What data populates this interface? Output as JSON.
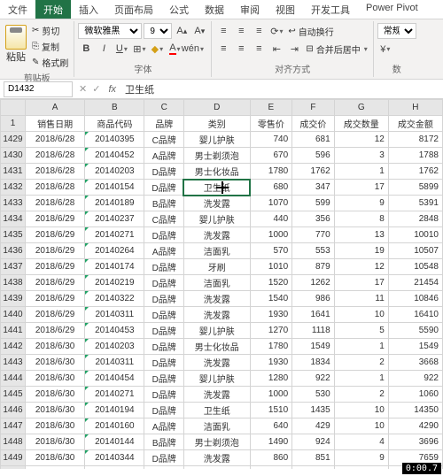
{
  "tabs": [
    "文件",
    "开始",
    "插入",
    "页面布局",
    "公式",
    "数据",
    "审阅",
    "视图",
    "开发工具",
    "Power Pivot"
  ],
  "activeTab": 1,
  "ribbon": {
    "paste": "粘贴",
    "cut": "剪切",
    "copy": "复制",
    "formatPainter": "格式刷",
    "clipboardLabel": "剪贴板",
    "fontName": "微软雅黑",
    "fontSize": "9",
    "fontLabel": "字体",
    "wrap": "自动换行",
    "merge": "合并后居中",
    "alignLabel": "对齐方式",
    "numFormat": "常规",
    "numLabel": "数"
  },
  "nameBox": "D1432",
  "formulaValue": "卫生纸",
  "columns": [
    "",
    "A",
    "B",
    "C",
    "D",
    "E",
    "F",
    "G",
    "H"
  ],
  "headerRow": [
    "1",
    "销售日期",
    "商品代码",
    "品牌",
    "类别",
    "零售价",
    "成交价",
    "成交数量",
    "成交金额"
  ],
  "rows": [
    [
      "1429",
      "2018/6/28",
      "20140395",
      "C品牌",
      "婴儿护肤",
      "740",
      "681",
      "12",
      "8172"
    ],
    [
      "1430",
      "2018/6/28",
      "20140452",
      "A品牌",
      "男士剃须泡",
      "670",
      "596",
      "3",
      "1788"
    ],
    [
      "1431",
      "2018/6/28",
      "20140203",
      "D品牌",
      "男士化妆品",
      "1780",
      "1762",
      "1",
      "1762"
    ],
    [
      "1432",
      "2018/6/28",
      "20140154",
      "D品牌",
      "卫生纸",
      "680",
      "347",
      "17",
      "5899"
    ],
    [
      "1433",
      "2018/6/28",
      "20140189",
      "B品牌",
      "洗发露",
      "1070",
      "599",
      "9",
      "5391"
    ],
    [
      "1434",
      "2018/6/29",
      "20140237",
      "C品牌",
      "婴儿护肤",
      "440",
      "356",
      "8",
      "2848"
    ],
    [
      "1435",
      "2018/6/29",
      "20140271",
      "D品牌",
      "洗发露",
      "1000",
      "770",
      "13",
      "10010"
    ],
    [
      "1436",
      "2018/6/29",
      "20140264",
      "A品牌",
      "洁面乳",
      "570",
      "553",
      "19",
      "10507"
    ],
    [
      "1437",
      "2018/6/29",
      "20140174",
      "D品牌",
      "牙刷",
      "1010",
      "879",
      "12",
      "10548"
    ],
    [
      "1438",
      "2018/6/29",
      "20140219",
      "D品牌",
      "洁面乳",
      "1520",
      "1262",
      "17",
      "21454"
    ],
    [
      "1439",
      "2018/6/29",
      "20140322",
      "D品牌",
      "洗发露",
      "1540",
      "986",
      "11",
      "10846"
    ],
    [
      "1440",
      "2018/6/29",
      "20140311",
      "D品牌",
      "洗发露",
      "1930",
      "1641",
      "10",
      "16410"
    ],
    [
      "1441",
      "2018/6/29",
      "20140453",
      "D品牌",
      "婴儿护肤",
      "1270",
      "1118",
      "5",
      "5590"
    ],
    [
      "1442",
      "2018/6/30",
      "20140203",
      "D品牌",
      "男士化妆品",
      "1780",
      "1549",
      "1",
      "1549"
    ],
    [
      "1443",
      "2018/6/30",
      "20140311",
      "D品牌",
      "洗发露",
      "1930",
      "1834",
      "2",
      "3668"
    ],
    [
      "1444",
      "2018/6/30",
      "20140454",
      "D品牌",
      "婴儿护肤",
      "1280",
      "922",
      "1",
      "922"
    ],
    [
      "1445",
      "2018/6/30",
      "20140271",
      "D品牌",
      "洗发露",
      "1000",
      "530",
      "2",
      "1060"
    ],
    [
      "1446",
      "2018/6/30",
      "20140194",
      "D品牌",
      "卫生纸",
      "1510",
      "1435",
      "10",
      "14350"
    ],
    [
      "1447",
      "2018/6/30",
      "20140160",
      "A品牌",
      "洁面乳",
      "640",
      "429",
      "10",
      "4290"
    ],
    [
      "1448",
      "2018/6/30",
      "20140144",
      "B品牌",
      "男士剃须泡",
      "1490",
      "924",
      "4",
      "3696"
    ],
    [
      "1449",
      "2018/6/30",
      "20140344",
      "D品牌",
      "洗发露",
      "860",
      "851",
      "9",
      "7659"
    ],
    [
      "1450",
      "",
      "",
      "",
      "",
      "",
      "",
      "",
      ""
    ]
  ],
  "selectedCell": {
    "row": "1432",
    "col": "D"
  },
  "timer": "0:00.7"
}
